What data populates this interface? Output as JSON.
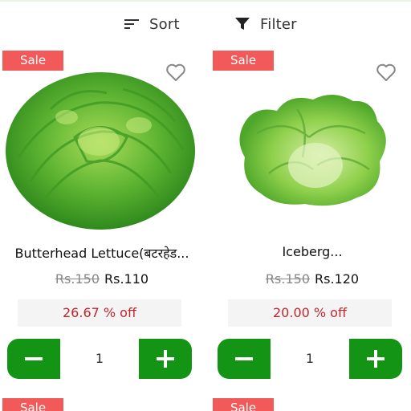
{
  "toolbar": {
    "sort_label": "Sort",
    "filter_label": "Filter"
  },
  "products": [
    {
      "badge": "Sale",
      "title": "Butterhead Lettuce(बटरहेड...",
      "old_price": "Rs.150",
      "new_price": "Rs.110",
      "discount": "26.67 % off",
      "quantity": "1",
      "image": "butterhead-lettuce"
    },
    {
      "badge": "Sale",
      "title": "Iceberg...",
      "old_price": "Rs.150",
      "new_price": "Rs.120",
      "discount": "20.00 % off",
      "quantity": "1",
      "image": "iceberg-lettuce"
    }
  ],
  "next_row_badges": [
    "Sale",
    "Sale"
  ],
  "colors": {
    "sale_badge": "#f25a5a",
    "qty_button": "#149414",
    "discount_text": "#c0272d",
    "discount_bg": "#f4f4f4"
  },
  "icons": {
    "sort": "sort-lines-icon",
    "filter": "funnel-icon",
    "wishlist": "heart-outline-icon",
    "decrease": "minus-icon",
    "increase": "plus-icon"
  }
}
